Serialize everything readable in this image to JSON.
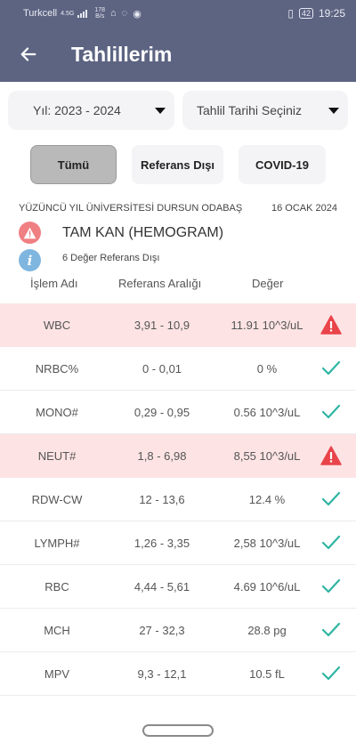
{
  "status_bar": {
    "carrier": "Turkcell",
    "network": "4.5G",
    "speed_value": "178",
    "speed_unit": "B/s",
    "battery": "42",
    "time": "19:25"
  },
  "header": {
    "title": "Tahlillerim",
    "back_icon": "arrow-left-icon"
  },
  "filters": {
    "year_select": "Yıl: 2023 - 2024",
    "date_select": "Tahlil Tarihi Seçiniz"
  },
  "tabs": [
    {
      "label": "Tümü",
      "selected": true
    },
    {
      "label": "Referans Dışı",
      "selected": false
    },
    {
      "label": "COVID-19",
      "selected": false
    }
  ],
  "report": {
    "institution": "YÜZÜNCÜ YIL ÜNİVERSİTESİ DURSUN ODABAŞ",
    "date": "16 OCAK 2024",
    "test_name": "TAM KAN (HEMOGRAM)",
    "out_of_range_text": "6 Değer Referans Dışı"
  },
  "table": {
    "headers": {
      "name": "İşlem Adı",
      "range": "Referans Aralığı",
      "value": "Değer"
    },
    "rows": [
      {
        "name": "WBC",
        "range": "3,91 - 10,9",
        "value": "11.91 10^3/uL",
        "status": "alert"
      },
      {
        "name": "NRBC%",
        "range": "0 - 0,01",
        "value": "0 %",
        "status": "ok"
      },
      {
        "name": "MONO#",
        "range": "0,29 - 0,95",
        "value": "0.56 10^3/uL",
        "status": "ok"
      },
      {
        "name": "NEUT#",
        "range": "1,8 - 6,98",
        "value": "8,55 10^3/uL",
        "status": "alert"
      },
      {
        "name": "RDW-CW",
        "range": "12 - 13,6",
        "value": "12.4 %",
        "status": "ok"
      },
      {
        "name": "LYMPH#",
        "range": "1,26 - 3,35",
        "value": "2,58 10^3/uL",
        "status": "ok"
      },
      {
        "name": "RBC",
        "range": "4,44 - 5,61",
        "value": "4.69 10^6/uL",
        "status": "ok"
      },
      {
        "name": "MCH",
        "range": "27 - 32,3",
        "value": "28.8 pg",
        "status": "ok"
      },
      {
        "name": "MPV",
        "range": "9,3 - 12,1",
        "value": "10.5 fL",
        "status": "ok"
      }
    ]
  },
  "colors": {
    "app_bar": "#5d6482",
    "alert_row": "#fde3e4",
    "alert_icon": "#e8444a",
    "ok_check": "#2fb5a3",
    "info_badge": "#7eb6df",
    "warning_badge": "#ef7f82"
  }
}
